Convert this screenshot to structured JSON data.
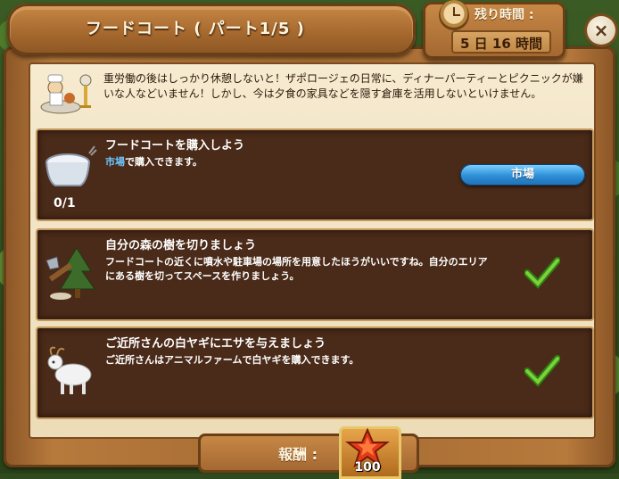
{
  "window": {
    "title": "フードコート ( パート1/5 )",
    "close_label": "×"
  },
  "timer": {
    "label": "残り時間 :",
    "value": "5 日 16 時間"
  },
  "intro": {
    "text": "重労働の後はしっかり休憩しないと！ザポロージェの日常に、ディナーパーティーとピクニックが嫌いな人などいません！しかし、今は夕食の家具などを隠す倉庫を活用しないといけません。"
  },
  "quests": [
    {
      "title": "フードコートを購入しよう",
      "desc_link": "市場",
      "desc_rest": "で購入できます。",
      "progress": "0/1",
      "button": "市場",
      "icon": "table-icon",
      "completed": false
    },
    {
      "title": "自分の森の樹を切りましょう",
      "desc": "フードコートの近くに噴水や駐車場の場所を用意したほうがいいですね。自分のエリアにある樹を切ってスペースを作りましょう。",
      "icon": "axe-tree-icon",
      "completed": true
    },
    {
      "title": "ご近所さんの白ヤギにエサを与えましょう",
      "desc": "ご近所さんはアニマルファームで白ヤギを購入できます。",
      "icon": "goat-icon",
      "completed": true
    }
  ],
  "reward": {
    "label": "報酬 :",
    "value": "100",
    "icon": "star-icon"
  },
  "colors": {
    "quest_bg": "#4a2a18",
    "link": "#6cc8ff",
    "button": "#2e8fd8",
    "check": "#3fa51f"
  }
}
